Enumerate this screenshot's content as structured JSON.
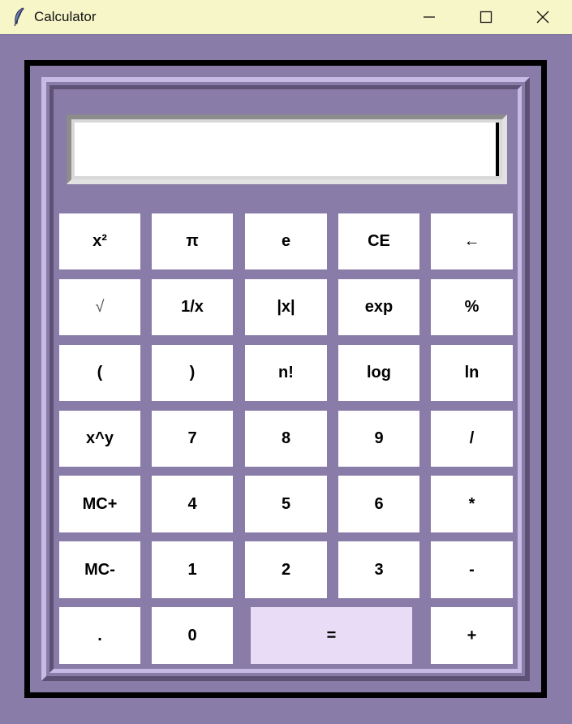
{
  "window": {
    "title": "Calculator",
    "icon": "feather-icon",
    "controls": [
      "minimize-icon",
      "maximize-icon",
      "close-icon"
    ]
  },
  "display": {
    "value": ""
  },
  "keys": {
    "square": "x²",
    "pi": "π",
    "e": "e",
    "clear_entry": "CE",
    "backspace": "←",
    "sqrt": "√",
    "reciprocal": "1/x",
    "abs": "|x|",
    "exp": "exp",
    "percent": "%",
    "open_paren": "(",
    "close_paren": ")",
    "factorial": "n!",
    "log": "log",
    "ln": "ln",
    "power": "x^y",
    "seven": "7",
    "eight": "8",
    "nine": "9",
    "divide": "/",
    "mc_plus": "MC+",
    "four": "4",
    "five": "5",
    "six": "6",
    "multiply": "*",
    "mc_minus": "MC-",
    "one": "1",
    "two": "2",
    "three": "3",
    "minus": "-",
    "dot": ".",
    "zero": "0",
    "equals": "=",
    "plus": "+"
  },
  "colors": {
    "background": "#8a7ca8",
    "titlebar": "#f7f6c9",
    "key": "#ffffff",
    "equals_key": "#e8dcf7"
  }
}
